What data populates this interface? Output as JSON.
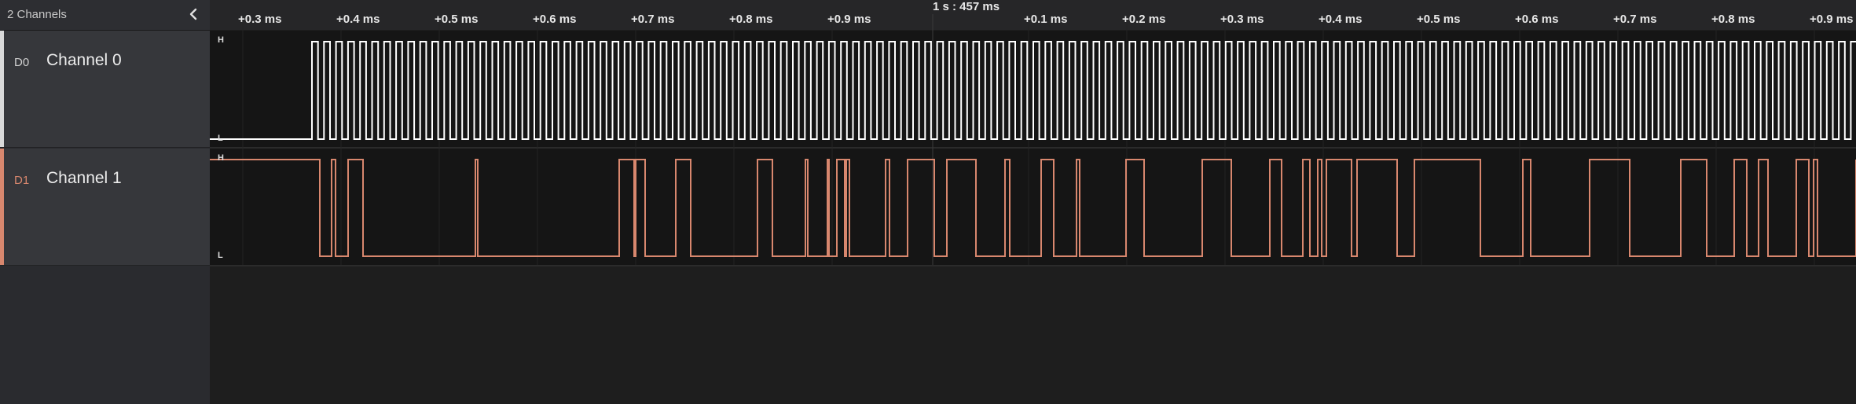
{
  "sidebar": {
    "title": "2 Channels",
    "channels": [
      {
        "tag": "D0",
        "name": "Channel 0",
        "color": "#ffffff"
      },
      {
        "tag": "D1",
        "name": "Channel 1",
        "color": "#d8876e"
      }
    ]
  },
  "timeline": {
    "reference_label": "1 s : 457 ms",
    "ticks": [
      "+0.3 ms",
      "+0.4 ms",
      "+0.5 ms",
      "+0.6 ms",
      "+0.7 ms",
      "+0.8 ms",
      "+0.9 ms",
      "+0.1 ms",
      "+0.2 ms",
      "+0.3 ms",
      "+0.4 ms",
      "+0.5 ms",
      "+0.6 ms",
      "+0.7 ms",
      "+0.8 ms",
      "+0.9 ms"
    ]
  },
  "levels": {
    "high": "H",
    "low": "L"
  },
  "icons": {
    "collapse": "chevron-left-icon"
  }
}
